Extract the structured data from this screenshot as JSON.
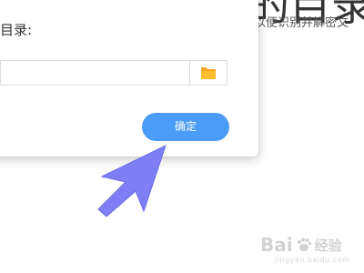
{
  "background": {
    "heading_fragment": "的目录",
    "text_fragment": "以便识别并解密文"
  },
  "dialog": {
    "directory_label": "目录:",
    "path_input": {
      "value": "",
      "placeholder": ""
    },
    "browse_icon": "folder-icon",
    "confirm_label": "确定"
  },
  "overlay": {
    "cursor_icon": "arrow-cursor-icon"
  },
  "watermark": {
    "brand": "Bai",
    "brand_cn": "经验",
    "subtitle": "jingyan.baidu.com"
  },
  "colors": {
    "accent": "#4a9cf6",
    "folder": "#f5a623",
    "cursor": "#7f7ff5"
  }
}
